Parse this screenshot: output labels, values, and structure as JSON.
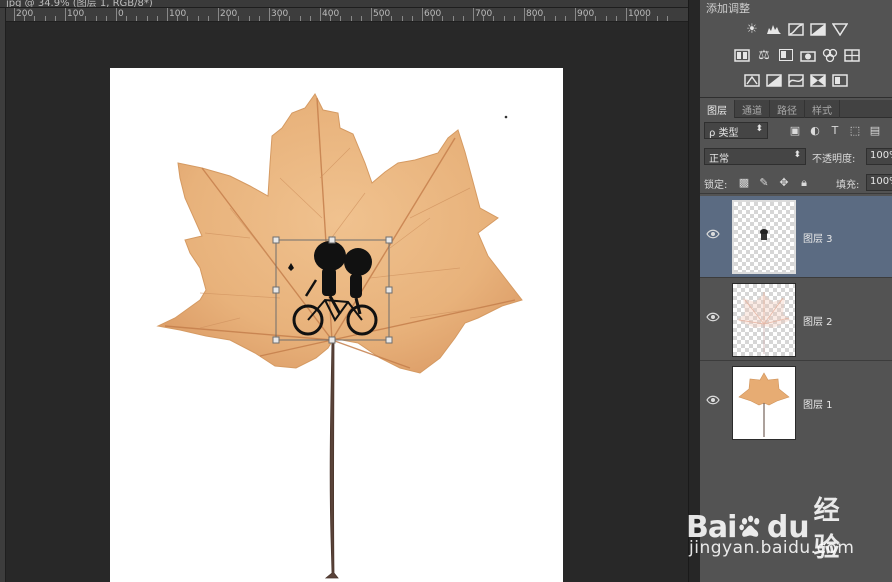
{
  "document": {
    "tab_title": "jpg @ 34.9% (图层 1, RGB/8*)",
    "ruler_labels": [
      "200",
      "100",
      "0",
      "100",
      "200",
      "300",
      "400",
      "500",
      "600",
      "700",
      "800",
      "900",
      "1000"
    ]
  },
  "adjustments": {
    "title": "添加调整",
    "rows": [
      [
        "brightness-icon",
        "levels-icon",
        "curves-icon",
        "exposure-icon",
        "vibrance-icon"
      ],
      [
        "hue-saturation-icon",
        "color-balance-icon",
        "black-white-icon",
        "photo-filter-icon",
        "channel-mixer-icon",
        "color-lookup-icon"
      ],
      [
        "invert-icon",
        "posterize-icon",
        "threshold-icon",
        "selective-color-icon",
        "gradient-map-icon"
      ]
    ]
  },
  "layers_panel": {
    "tabs": [
      {
        "label": "图层",
        "active": true
      },
      {
        "label": "通道",
        "active": false
      },
      {
        "label": "路径",
        "active": false
      },
      {
        "label": "样式",
        "active": false
      }
    ],
    "filter": {
      "label": "ρ 类型"
    },
    "blend_mode": "正常",
    "opacity_label": "不透明度:",
    "opacity_value": "100%",
    "lock_label": "锁定:",
    "fill_label": "填充:",
    "fill_value": "100%",
    "layers": [
      {
        "name": "图层 3",
        "selected": true,
        "visible": true
      },
      {
        "name": "图层 2",
        "selected": false,
        "visible": true
      },
      {
        "name": "图层 1",
        "selected": false,
        "visible": true
      }
    ]
  },
  "watermark": {
    "brand_part1": "Bai",
    "brand_part2": "du",
    "brand_suffix": "经验",
    "url": "jingyan.baidu.com"
  },
  "colors": {
    "leaf": "#e9b47e",
    "leaf_vein": "#c98a57",
    "selected_layer": "#5b6b82",
    "panel_bg": "#535353",
    "workspace_bg": "#282828"
  }
}
